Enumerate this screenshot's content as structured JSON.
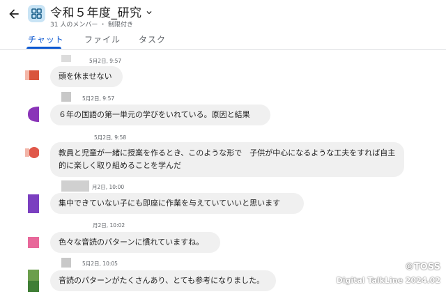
{
  "header": {
    "title": "令和５年度_研究",
    "subtitle": "31 人のメンバー ・ 制限付き",
    "back_icon": "arrow-back-icon",
    "space_icon": "grid-space-icon",
    "dropdown_icon": "chevron-down-icon"
  },
  "tabs": [
    {
      "label": "チャット",
      "active": true
    },
    {
      "label": "ファイル",
      "active": false
    },
    {
      "label": "タスク",
      "active": false
    }
  ],
  "messages": [
    {
      "time": "5月2日, 9:57",
      "text": "頭を休ませない",
      "avatar_color": "#d9553c"
    },
    {
      "time": "5月2日, 9:57",
      "text": "６年の国語の第一単元の学びをいれている。原因と結果",
      "avatar_color": "#8a34b8"
    },
    {
      "time": "5月2日, 9:58",
      "text": "教員と児童が一緒に授業を作るとき、このような形で　子供が中心になるような工夫をすれば自主的に楽しく取り組めることを学んだ",
      "avatar_color": "#e0584a"
    },
    {
      "time": "月2日, 10:00",
      "text": "集中できていない子にも即座に作業を与えていていいと思います",
      "avatar_color": "#7b3fc0"
    },
    {
      "time": "月2日, 10:02",
      "text": "色々な音読のパターンに慣れていますね。",
      "avatar_color": "#e8689a"
    },
    {
      "time": "5月2日, 10:05",
      "text": "音読のパターンがたくさんあり、とても参考になりました。",
      "avatar_color": "#4c8a3c"
    }
  ],
  "watermark": {
    "line1": "©TOSS",
    "line2": "Digital TalkLine 2024.02"
  },
  "colors": {
    "accent": "#0b57d0",
    "bubble": "#f0f0f0",
    "meta_text": "#5f6368"
  }
}
